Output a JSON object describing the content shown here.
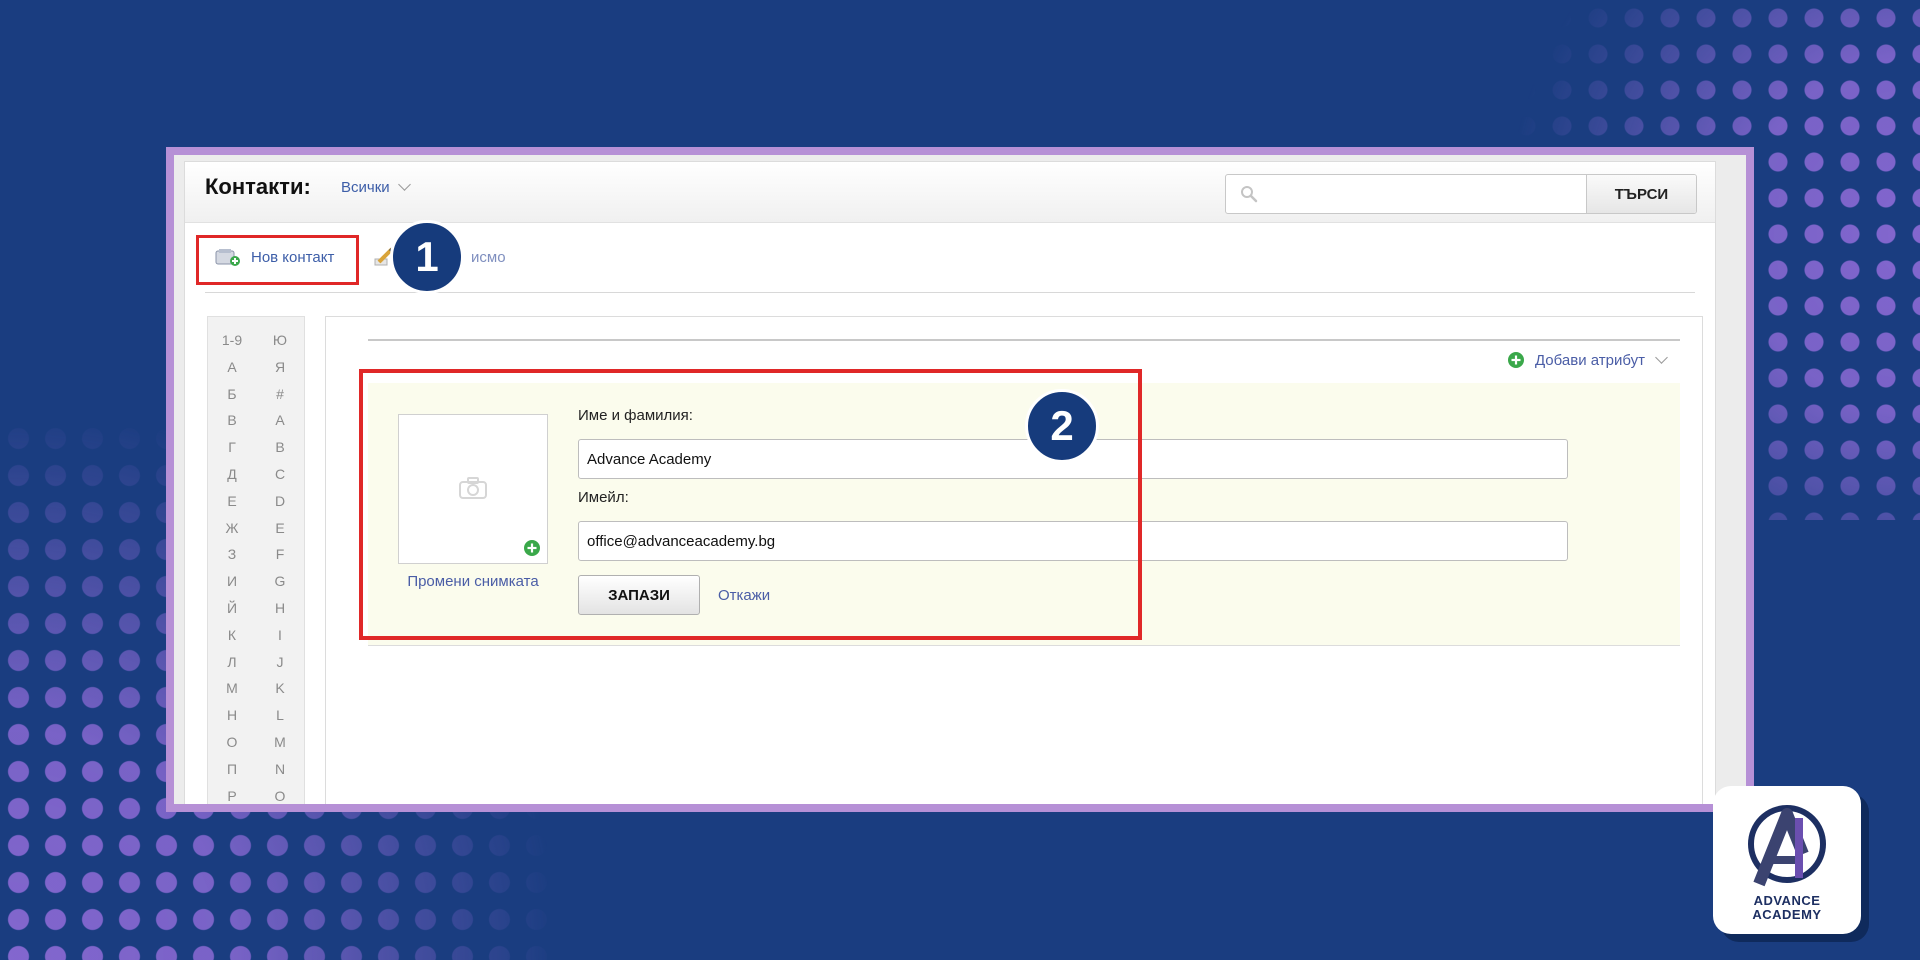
{
  "header": {
    "title": "Контакти:",
    "filter_label": "Всички",
    "search_placeholder": "",
    "search_button": "ТЪРСИ"
  },
  "toolbar": {
    "new_contact": "Нов контакт",
    "letter": "исмо"
  },
  "alphabet": {
    "column_left": [
      "1-9",
      "А",
      "Б",
      "В",
      "Г",
      "Д",
      "Е",
      "Ж",
      "З",
      "И",
      "Й",
      "К",
      "Л",
      "М",
      "Н",
      "О",
      "П",
      "Р"
    ],
    "column_right": [
      "Ю",
      "Я",
      "#",
      "A",
      "B",
      "C",
      "D",
      "E",
      "F",
      "G",
      "H",
      "I",
      "J",
      "K",
      "L",
      "M",
      "N",
      "O"
    ]
  },
  "form": {
    "add_attribute": "Добави атрибут",
    "name_label": "Име и фамилия:",
    "name_value": "Advance Academy",
    "email_label": "Имейл:",
    "email_value": "office@advanceacademy.bg",
    "change_photo": "Промени снимката",
    "save_button": "ЗАПАЗИ",
    "cancel_link": "Откажи"
  },
  "annotations": {
    "badge_1": "1",
    "badge_2": "2",
    "highlight_color": "#e02828",
    "badge_color": "#163b7c"
  },
  "brand": {
    "logo_line1": "ADVANCE",
    "logo_line2": "ACADEMY",
    "background_color": "#1a3d80",
    "frame_color": "#b690d6"
  }
}
